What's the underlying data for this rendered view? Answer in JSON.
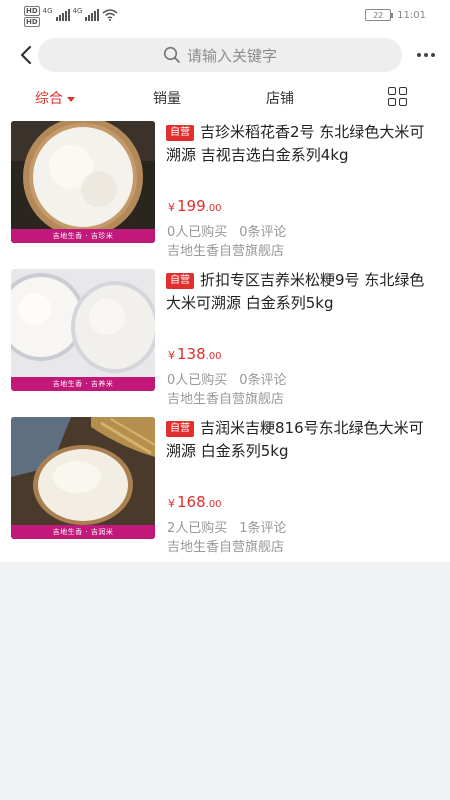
{
  "status_bar": {
    "hd1": "HD",
    "hd2": "HD",
    "network1": "4G",
    "network2": "4G",
    "battery": "22",
    "time": "11:01"
  },
  "header": {
    "search_placeholder": "请输入关键字"
  },
  "tabs": [
    {
      "label": "综合",
      "active": true
    },
    {
      "label": "销量",
      "active": false
    },
    {
      "label": "店铺",
      "active": false
    }
  ],
  "products": [
    {
      "badge": "自营",
      "title": "吉珍米稻花香2号 东北绿色大米可溯源 吉视吉选白金系列4kg",
      "currency": "¥",
      "price_int": "199",
      "price_dec": ".00",
      "sold": "0人已购买",
      "reviews": "0条评论",
      "shop": "吉地生香自营旗舰店",
      "image_caption": "吉地生香 · 吉珍米"
    },
    {
      "badge": "自营",
      "title": "折扣专区吉养米松粳9号 东北绿色大米可溯源 白金系列5kg",
      "currency": "¥",
      "price_int": "138",
      "price_dec": ".00",
      "sold": "0人已购买",
      "reviews": "0条评论",
      "shop": "吉地生香自营旗舰店",
      "image_caption": "吉地生香 · 吉养米"
    },
    {
      "badge": "自营",
      "title": "吉润米吉粳816号东北绿色大米可溯源 白金系列5kg",
      "currency": "¥",
      "price_int": "168",
      "price_dec": ".00",
      "sold": "2人已购买",
      "reviews": "1条评论",
      "shop": "吉地生香自营旗舰店",
      "image_caption": "吉地生香 · 吉润米"
    }
  ],
  "colors": {
    "accent": "#e0322f",
    "caption_bg": "#c2187a",
    "page_bg": "#f0f1f3"
  }
}
